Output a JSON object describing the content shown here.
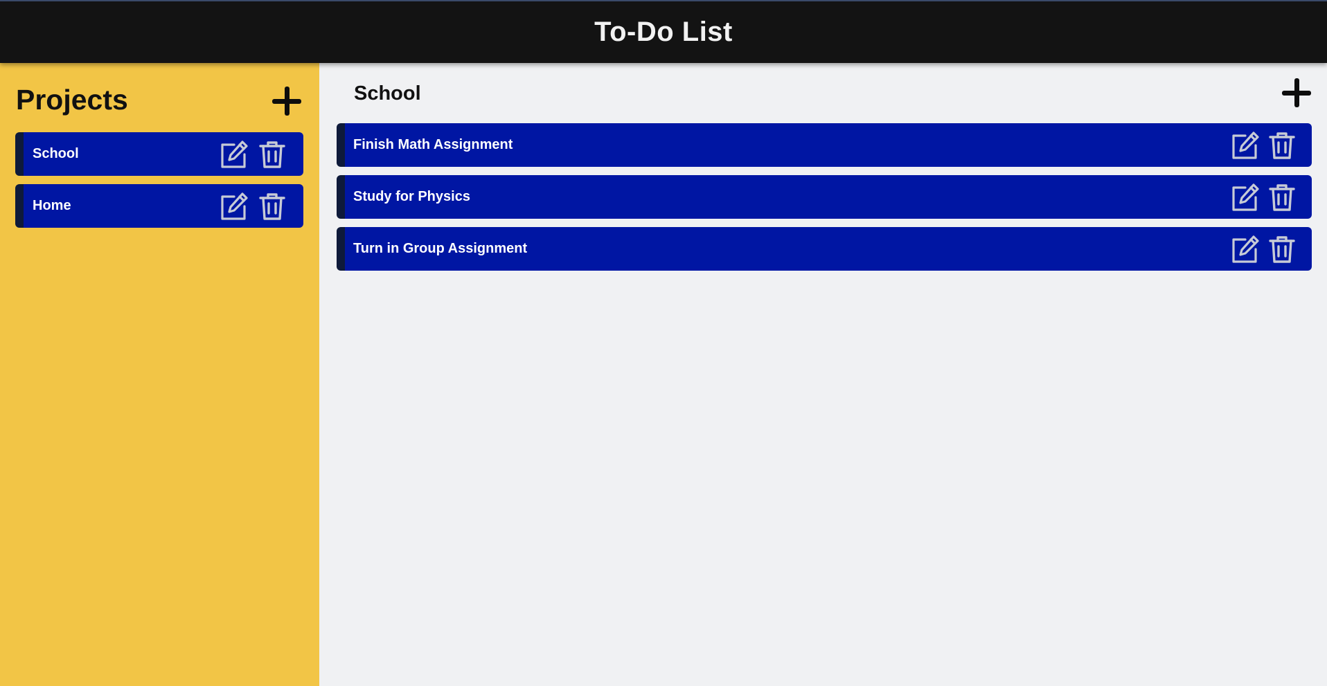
{
  "app": {
    "title": "To-Do List"
  },
  "sidebar": {
    "title": "Projects",
    "add_icon": "plus-icon",
    "projects": [
      {
        "label": "School"
      },
      {
        "label": "Home"
      }
    ]
  },
  "main": {
    "title": "School",
    "add_icon": "plus-icon",
    "tasks": [
      {
        "label": "Finish Math Assignment"
      },
      {
        "label": "Study for Physics"
      },
      {
        "label": "Turn in Group Assignment"
      }
    ]
  },
  "colors": {
    "header_bg": "#131313",
    "sidebar_bg": "#f2c546",
    "item_bg": "#0016a3",
    "item_accent": "#0e1a3a",
    "main_bg": "#f0f1f3",
    "icon": "#c7cbd6"
  },
  "icons": {
    "edit": "edit-icon",
    "delete": "trash-icon",
    "add": "plus-icon"
  }
}
